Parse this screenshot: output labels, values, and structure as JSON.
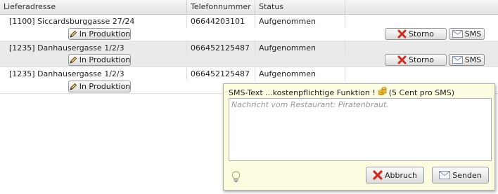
{
  "columns": [
    "Lieferadresse",
    "Telefonnummer",
    "Status"
  ],
  "rows": [
    {
      "address": "[1100] Siccardsburggasse 27/24",
      "phone": "06644203101",
      "status": "Aufgenommen",
      "production_label": "In Produktion"
    },
    {
      "address": "[1235] Danhausergasse 1/2/3",
      "phone": "066452125487",
      "status": "Aufgenommen",
      "production_label": "In Produktion"
    },
    {
      "address": "[1235] Danhausergasse 1/2/3",
      "phone": "066452125487",
      "status": "Aufgenommen",
      "production_label": "In Produktion"
    }
  ],
  "actions": {
    "storno_label": "Storno",
    "sms_label": "SMS"
  },
  "sms_popup": {
    "title_prefix": "SMS-Text ...kostenpflichtige Funktion !",
    "title_suffix": "(5 Cent pro SMS)",
    "text_value": "Nachricht vom Restaurant: Piratenbraut.",
    "cancel_label": "Abbruch",
    "send_label": "Senden"
  },
  "icons": {
    "production": "pencil-icon",
    "storno": "red-x-icon",
    "sms": "envelope-icon",
    "coins": "coins-icon",
    "hint": "lightbulb-icon"
  },
  "colors": {
    "cancel_red": "#d42a1c",
    "popup_bg": "#fdfde2",
    "row_alt": "#eaeaea"
  }
}
